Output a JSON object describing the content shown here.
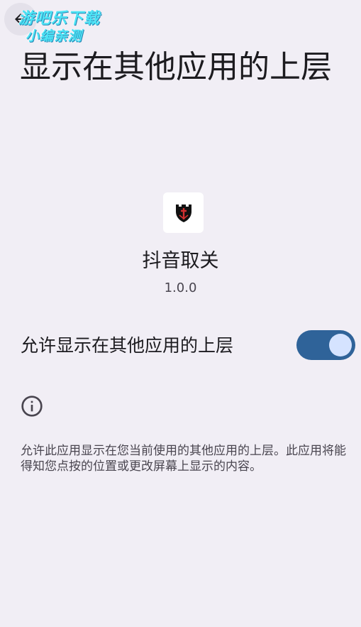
{
  "header": {
    "back_icon": "arrow-back-icon",
    "title": "显示在其他应用的上层"
  },
  "watermark": {
    "line1": "游吧乐下载",
    "line2": "小编亲测"
  },
  "app": {
    "icon": "app-logo-icon",
    "name": "抖音取关",
    "version": "1.0.0"
  },
  "setting": {
    "label": "允许显示在其他应用的上层",
    "enabled": true
  },
  "info": {
    "icon": "info-icon",
    "description": "允许此应用显示在您当前使用的其他应用的上层。此应用将能得知您点按的位置或更改屏幕上显示的内容。"
  },
  "colors": {
    "background": "#F1EEF5",
    "toggle_track": "#2F6399",
    "toggle_thumb": "#D5E3FF",
    "text_primary": "#1C1B1F",
    "text_secondary": "#49454F"
  }
}
